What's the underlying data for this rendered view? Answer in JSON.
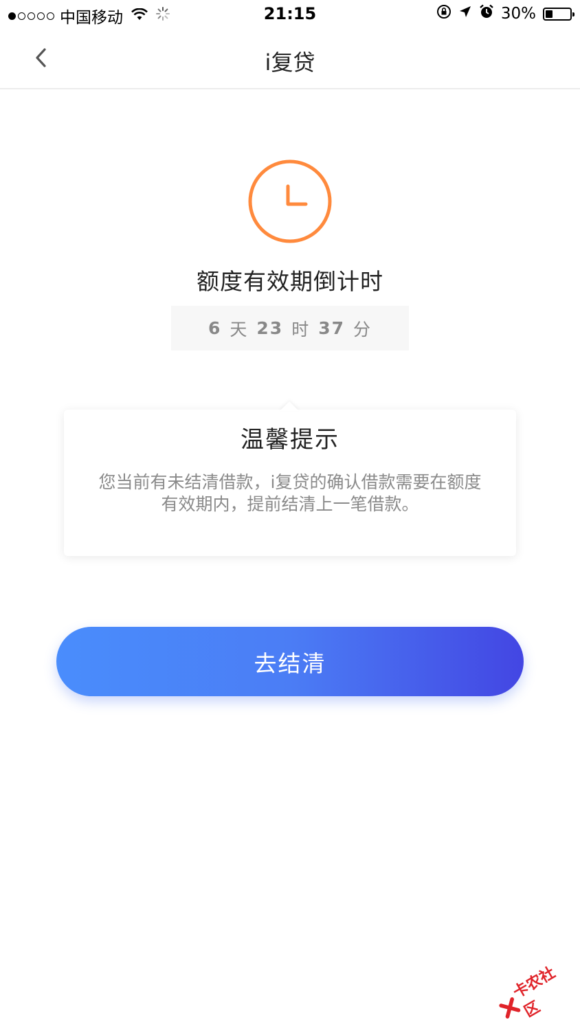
{
  "status_bar": {
    "carrier": "中国移动",
    "time": "21:15",
    "battery": "30%",
    "battery_level": 0.3,
    "signal_bars_filled": 1,
    "signal_bars_total": 5
  },
  "nav": {
    "title": "i复贷"
  },
  "main": {
    "headline": "额度有效期倒计时",
    "countdown": {
      "days": "6",
      "days_unit": "天",
      "hours": "23",
      "hours_unit": "时",
      "minutes": "37",
      "minutes_unit": "分"
    }
  },
  "tip": {
    "title": "温馨提示",
    "body_line1": "您当前有未结清借款，i复贷的确认借款需要在额度",
    "body_line2": "有效期内，提前结清上一笔借款。"
  },
  "action": {
    "settle_label": "去结清"
  },
  "watermark": {
    "text": "卡农社区"
  },
  "colors": {
    "accent_orange": "#ff8a3d",
    "button_start": "#4a8dfc",
    "button_end": "#4346e3",
    "watermark_red": "#e0242a"
  }
}
